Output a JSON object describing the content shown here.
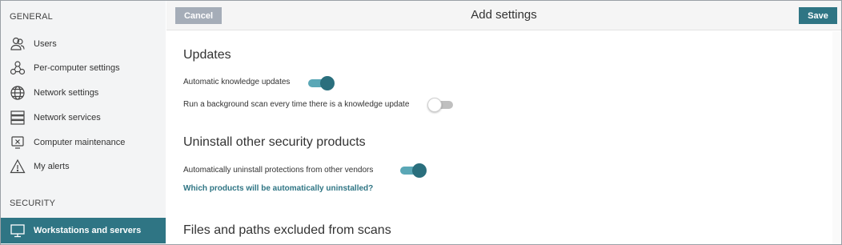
{
  "sidebar": {
    "general_heading": "GENERAL",
    "security_heading": "SECURITY",
    "items": [
      {
        "label": "Users",
        "icon": "users-icon"
      },
      {
        "label": "Per-computer settings",
        "icon": "per-computer-settings-icon"
      },
      {
        "label": "Network settings",
        "icon": "globe-icon"
      },
      {
        "label": "Network services",
        "icon": "server-icon"
      },
      {
        "label": "Computer maintenance",
        "icon": "computer-maintenance-icon"
      },
      {
        "label": "My alerts",
        "icon": "warning-icon"
      }
    ],
    "security_items": [
      {
        "label": "Workstations and servers",
        "icon": "monitor-icon",
        "active": true
      }
    ]
  },
  "header": {
    "cancel_label": "Cancel",
    "title": "Add settings",
    "save_label": "Save"
  },
  "sections": {
    "updates": {
      "title": "Updates",
      "auto_knowledge_label": "Automatic knowledge updates",
      "auto_knowledge_on": true,
      "background_scan_label": "Run a background scan every time there is a knowledge update",
      "background_scan_on": false
    },
    "uninstall": {
      "title": "Uninstall other security products",
      "auto_uninstall_label": "Automatically uninstall protections from other vendors",
      "auto_uninstall_on": true,
      "link_label": "Which products will be automatically uninstalled?"
    },
    "exclusions": {
      "title": "Files and paths excluded from scans"
    }
  },
  "colors": {
    "accent": "#2f7584",
    "toggle_on": "#5aa7b6",
    "sidebar_bg": "#f3f4f5",
    "cancel_bg": "#a5adb8"
  }
}
